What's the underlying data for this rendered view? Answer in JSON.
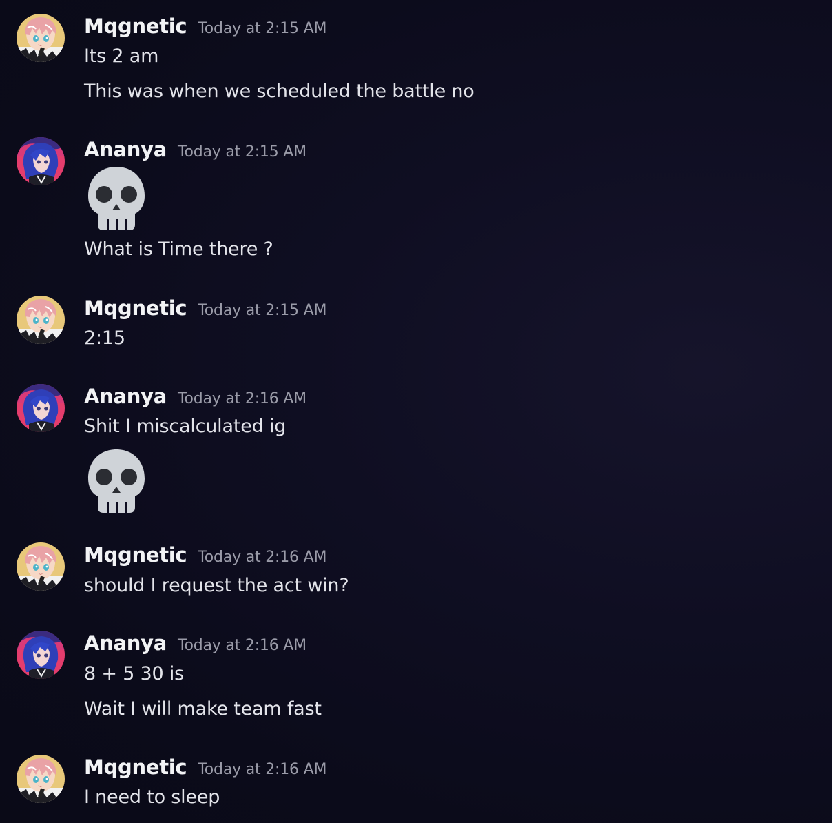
{
  "colors": {
    "background": "#0d0c1f",
    "username": "#f2f3f5",
    "timestamp": "#9a9ba8",
    "message_text": "#e3e4ea",
    "skull": "#cfd3d8",
    "skull_eyes": "#2b2d33"
  },
  "messages": [
    {
      "author": "Mqgnetic",
      "avatar_icon": "mqgnetic-avatar",
      "timestamp": "Today at 2:15 AM",
      "lines": [
        "Its 2 am",
        "This was when we scheduled the battle no"
      ]
    },
    {
      "author": "Ananya",
      "avatar_icon": "ananya-avatar",
      "timestamp": "Today at 2:15 AM",
      "emoji": "skull-emoji",
      "lines": [
        "What is Time there ?"
      ]
    },
    {
      "author": "Mqgnetic",
      "avatar_icon": "mqgnetic-avatar",
      "timestamp": "Today at 2:15 AM",
      "lines": [
        "2:15"
      ]
    },
    {
      "author": "Ananya",
      "avatar_icon": "ananya-avatar",
      "timestamp": "Today at 2:16 AM",
      "lines": [
        "Shit I miscalculated ig"
      ],
      "emoji": "skull-emoji"
    },
    {
      "author": "Mqgnetic",
      "avatar_icon": "mqgnetic-avatar",
      "timestamp": "Today at 2:16 AM",
      "lines": [
        "should I request the act win?"
      ]
    },
    {
      "author": "Ananya",
      "avatar_icon": "ananya-avatar",
      "timestamp": "Today at 2:16 AM",
      "lines": [
        "8 + 5 30 is",
        "Wait I will make team fast"
      ]
    },
    {
      "author": "Mqgnetic",
      "avatar_icon": "mqgnetic-avatar",
      "timestamp": "Today at 2:16 AM",
      "lines": [
        "I need to sleep"
      ]
    }
  ]
}
